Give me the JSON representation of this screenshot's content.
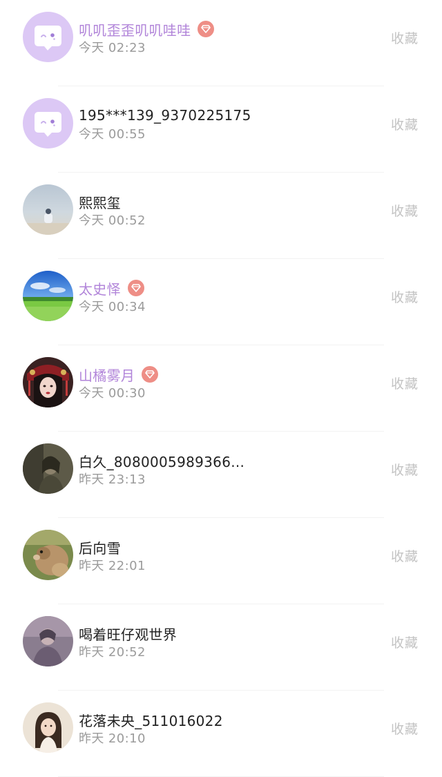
{
  "fav_label": "收藏",
  "accent_color": "#b184d9",
  "badge_color": "#ee8e86",
  "items": [
    {
      "name": "叽叽歪歪叽叽哇哇",
      "time": "今天 02:23",
      "vip": true,
      "avatar": "default-chat-avatar"
    },
    {
      "name": "195***139_9370225175",
      "time": "今天 00:55",
      "vip": false,
      "avatar": "default-chat-avatar"
    },
    {
      "name": "熙熙玺",
      "time": "今天 00:52",
      "vip": false,
      "avatar": "beach-photo-avatar"
    },
    {
      "name": "太史怿",
      "time": "今天 00:34",
      "vip": true,
      "avatar": "grassland-sky-avatar"
    },
    {
      "name": "山橘雾月",
      "time": "今天 00:30",
      "vip": true,
      "avatar": "costume-girl-avatar"
    },
    {
      "name": "白久_8080005989366...",
      "time": "昨天 23:13",
      "vip": false,
      "avatar": "dim-portrait-avatar"
    },
    {
      "name": "后向雪",
      "time": "昨天 22:01",
      "vip": false,
      "avatar": "animal-photo-avatar"
    },
    {
      "name": "喝着旺仔观世界",
      "time": "昨天 20:52",
      "vip": false,
      "avatar": "purple-portrait-avatar"
    },
    {
      "name": "花落未央_511016022",
      "time": "昨天 20:10",
      "vip": false,
      "avatar": "girl-portrait-avatar"
    }
  ]
}
